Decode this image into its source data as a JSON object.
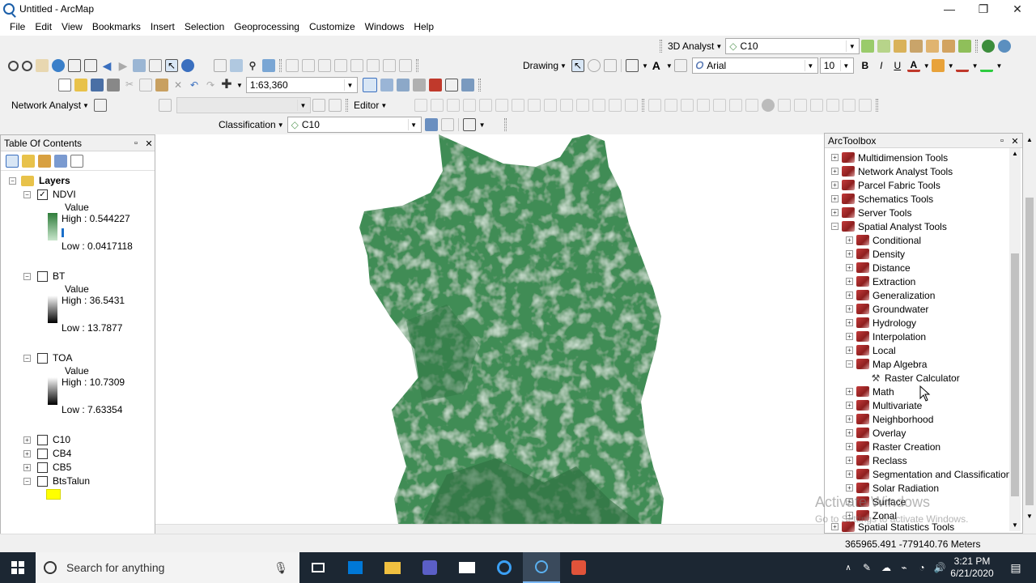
{
  "window": {
    "title": "Untitled - ArcMap"
  },
  "menu": [
    "File",
    "Edit",
    "View",
    "Bookmarks",
    "Insert",
    "Selection",
    "Geoprocessing",
    "Customize",
    "Windows",
    "Help"
  ],
  "toolbar3d": {
    "label": "3D Analyst",
    "layer": "C10"
  },
  "toolbar_draw": {
    "label": "Drawing",
    "font": "Arial",
    "size": "10",
    "bold": "B",
    "italic": "I",
    "underline": "U",
    "text_color": "A"
  },
  "toolbar_std": {
    "scale": "1:63,360"
  },
  "toolbar_na": {
    "label": "Network Analyst",
    "editor": "Editor"
  },
  "toolbar_class": {
    "label": "Classification",
    "layer": "C10"
  },
  "toc": {
    "title": "Table Of Contents",
    "layers_label": "Layers",
    "ndvi": {
      "name": "NDVI",
      "value": "Value",
      "high": "High : 0.544227",
      "low": "Low : 0.0417118",
      "checked": "✓"
    },
    "bt": {
      "name": "BT",
      "value": "Value",
      "high": "High : 36.5431",
      "low": "Low : 13.7877"
    },
    "toa": {
      "name": "TOA",
      "value": "Value",
      "high": "High : 10.7309",
      "low": "Low : 7.63354"
    },
    "others": [
      "C10",
      "CB4",
      "CB5",
      "BtsTalun"
    ]
  },
  "toolbox": {
    "title": "ArcToolbox",
    "top_items": [
      "Multidimension Tools",
      "Network Analyst Tools",
      "Parcel Fabric Tools",
      "Schematics Tools",
      "Server Tools",
      "Spatial Analyst Tools"
    ],
    "sa_items": [
      "Conditional",
      "Density",
      "Distance",
      "Extraction",
      "Generalization",
      "Groundwater",
      "Hydrology",
      "Interpolation",
      "Local",
      "Map Algebra"
    ],
    "tool": "Raster Calculator",
    "sa_items2": [
      "Math",
      "Multivariate",
      "Neighborhood",
      "Overlay",
      "Raster Creation",
      "Reclass",
      "Segmentation and Classification",
      "Solar Radiation",
      "Surface",
      "Zonal"
    ],
    "last": "Spatial Statistics Tools"
  },
  "status": {
    "coords": "365965.491  -779140.76 Meters"
  },
  "watermark": {
    "line1": "Activate Windows",
    "line2": "Go to Settings to activate Windows."
  },
  "taskbar": {
    "search": "Search for anything",
    "time": "3:21 PM",
    "date": "6/21/2020"
  },
  "colors": {
    "ndvi_high": "#2e7d3a",
    "ndvi_low": "#c8e6cc",
    "map_green": "#3f8c55",
    "taskbar": "#1c2733"
  }
}
